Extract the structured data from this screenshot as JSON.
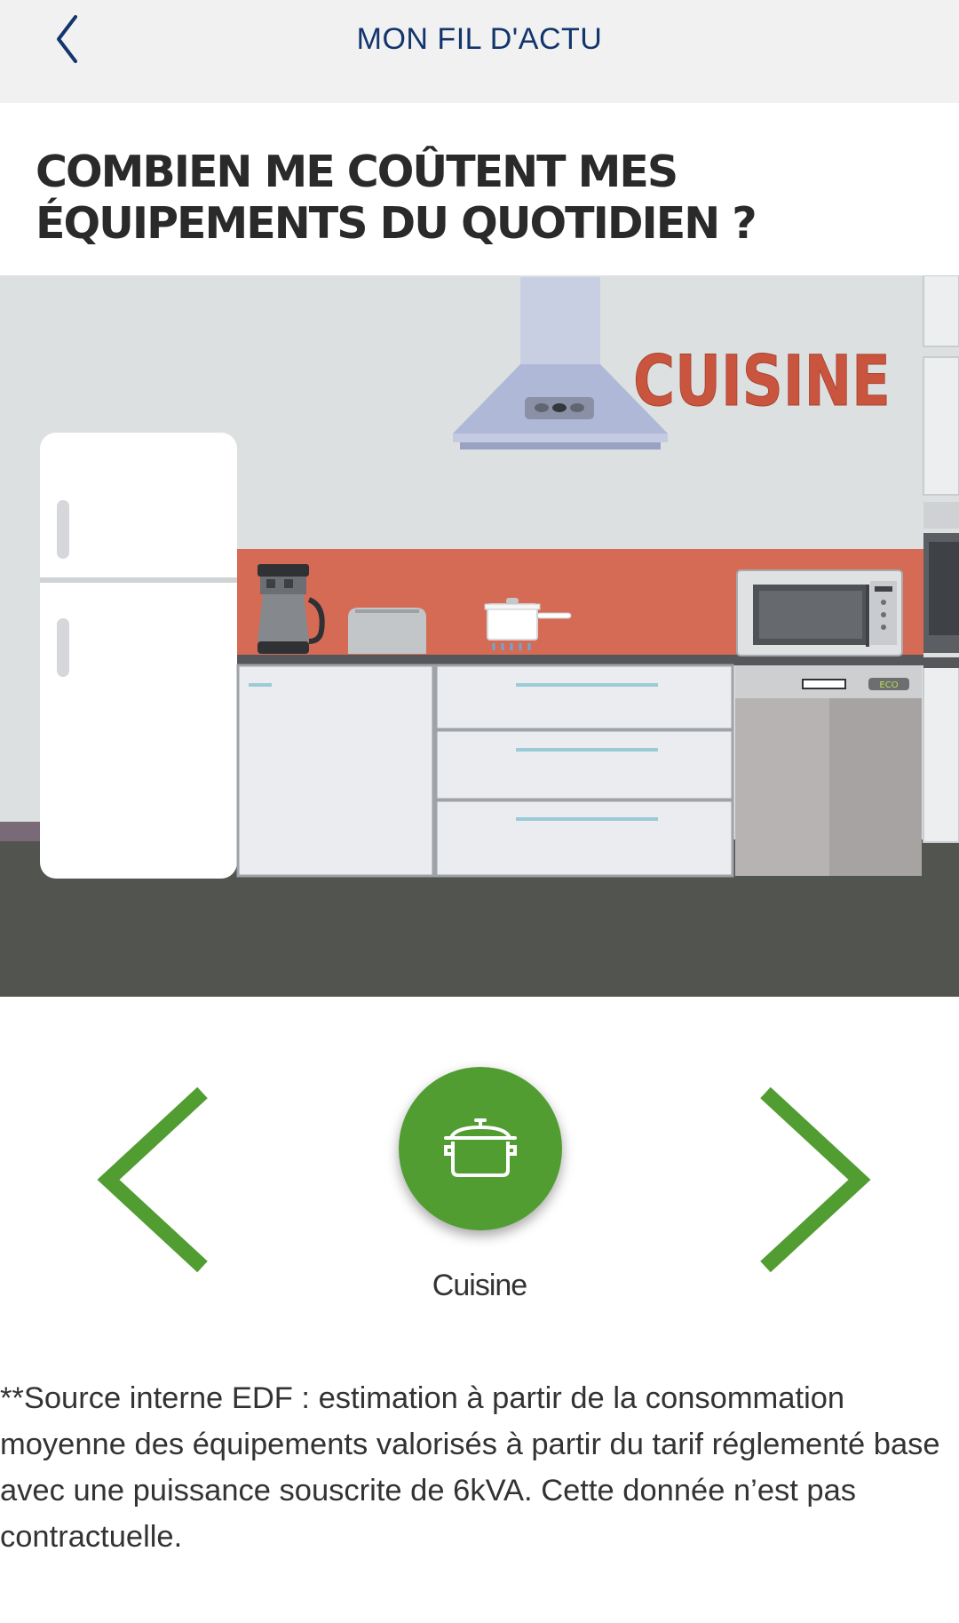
{
  "header": {
    "title": "MON FIL D'ACTU",
    "back_icon": "chevron-left-icon"
  },
  "article": {
    "title": "COMBIEN ME COÛTENT MES ÉQUIPEMENTS DU QUOTIDIEN ?"
  },
  "scene": {
    "room_label": "CUISINE",
    "dishwasher_badge": "ECO"
  },
  "carousel": {
    "prev_icon": "chevron-left-icon",
    "next_icon": "chevron-right-icon",
    "current_icon": "cooking-pot-icon",
    "current_label": "Cuisine",
    "accent_color": "#519d32"
  },
  "footnote": "**Source interne EDF : estimation à partir de la consommation moyenne des équipements valorisés à partir du tarif réglementé base avec une puissance souscrite de 6kVA. Cette donnée n’est pas contractuelle.",
  "colors": {
    "header_title": "#13356d",
    "backsplash": "#d66b55",
    "room_label": "#c9553e"
  }
}
